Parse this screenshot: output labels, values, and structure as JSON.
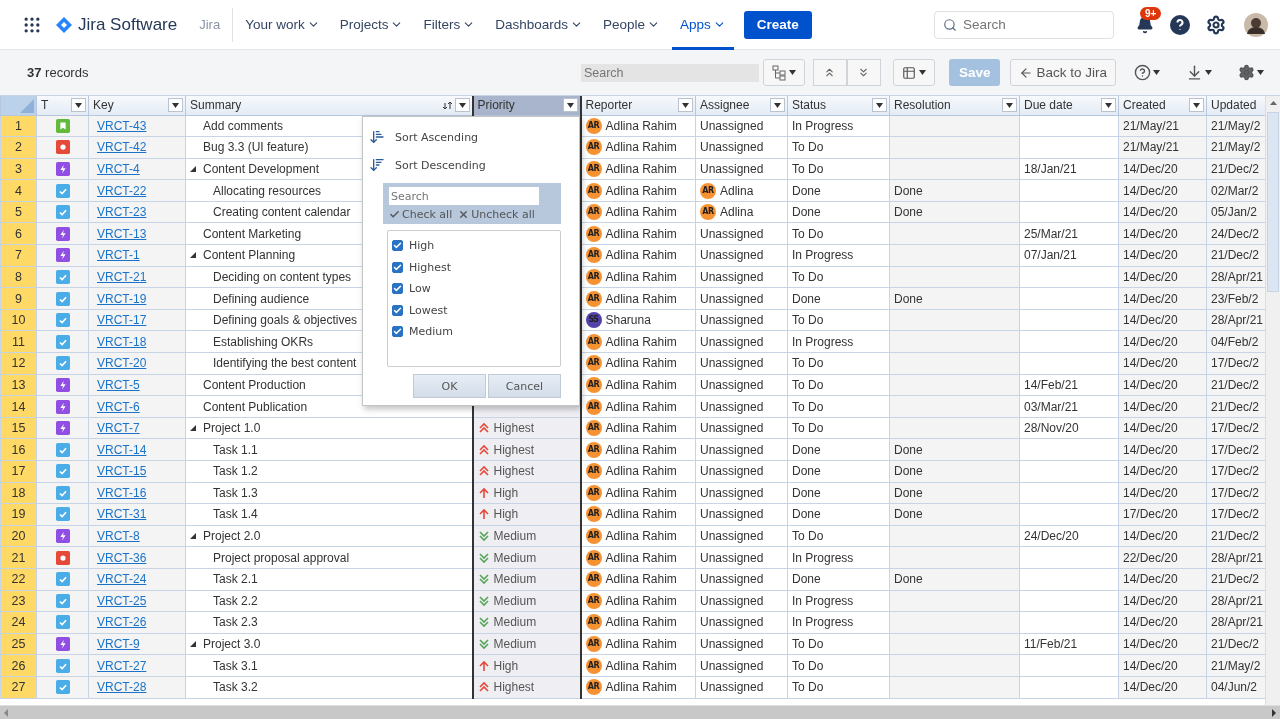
{
  "nav": {
    "product": "Jira Software",
    "site": "Jira",
    "items": [
      {
        "label": "Your work",
        "selected": false
      },
      {
        "label": "Projects",
        "selected": false
      },
      {
        "label": "Filters",
        "selected": false
      },
      {
        "label": "Dashboards",
        "selected": false
      },
      {
        "label": "People",
        "selected": false
      },
      {
        "label": "Apps",
        "selected": true
      }
    ],
    "create": "Create",
    "search": {
      "placeholder": "Search"
    },
    "notifications": "9+"
  },
  "toolbar": {
    "records": "**37** records",
    "search": {
      "placeholder": "Search"
    },
    "save": {
      "label": "Save",
      "disabled": true
    },
    "back": "Back to Jira"
  },
  "columns": [
    {
      "label": "T",
      "sorted": false,
      "active": false
    },
    {
      "label": "Key",
      "sorted": false,
      "active": false
    },
    {
      "label": "Summary",
      "sorted": true,
      "active": false
    },
    {
      "label": "Priority",
      "sorted": false,
      "active": true
    },
    {
      "label": "Reporter",
      "sorted": false,
      "active": false
    },
    {
      "label": "Assignee",
      "sorted": false,
      "active": false
    },
    {
      "label": "Status",
      "sorted": false,
      "active": false
    },
    {
      "label": "Resolution",
      "sorted": false,
      "active": false
    },
    {
      "label": "Due date",
      "sorted": false,
      "active": false
    },
    {
      "label": "Created",
      "sorted": false,
      "active": false
    },
    {
      "label": "Updated",
      "sorted": false,
      "active": false
    }
  ],
  "rows": [
    {
      "num": "1",
      "kind": "story",
      "key": "VRCT-43",
      "summary": "Add comments",
      "reporter": {
        "name": "Adlina Rahim",
        "initials": "AR",
        "color": "#f79232"
      },
      "assignee": {
        "name": "Unassigned"
      },
      "status": "In Progress",
      "created": "21/May/21",
      "updated": "21/May/2"
    },
    {
      "num": "2",
      "kind": "bug",
      "key": "VRCT-42",
      "summary": "Bug 3.3 (UI feature)",
      "reporter": {
        "name": "Adlina Rahim",
        "initials": "AR",
        "color": "#f79232"
      },
      "assignee": {
        "name": "Unassigned"
      },
      "status": "To Do",
      "created": "21/May/21",
      "updated": "21/May/2"
    },
    {
      "num": "3",
      "kind": "epic",
      "key": "VRCT-4",
      "summary": "Content Development",
      "expanded": true,
      "reporter": {
        "name": "Adlina Rahim",
        "initials": "AR",
        "color": "#f79232"
      },
      "assignee": {
        "name": "Unassigned"
      },
      "status": "To Do",
      "due": "18/Jan/21",
      "created": "14/Dec/20",
      "updated": "21/Dec/2",
      "children": [
        {
          "num": "4",
          "kind": "task",
          "key": "VRCT-22",
          "summary": "Allocating resources",
          "reporter": {
            "name": "Adlina Rahim",
            "initials": "AR",
            "color": "#f79232"
          },
          "assignee": {
            "name": "Adlina",
            "initials": "AR",
            "color": "#f79232"
          },
          "status": "Done",
          "resolution": "Done",
          "created": "14/Dec/20",
          "updated": "02/Mar/2"
        },
        {
          "num": "5",
          "kind": "task",
          "key": "VRCT-23",
          "summary": "Creating content calendar",
          "reporter": {
            "name": "Adlina Rahim",
            "initials": "AR",
            "color": "#f79232"
          },
          "assignee": {
            "name": "Adlina",
            "initials": "AR",
            "color": "#f79232"
          },
          "status": "Done",
          "resolution": "Done",
          "created": "14/Dec/20",
          "updated": "05/Jan/2"
        }
      ]
    },
    {
      "num": "6",
      "kind": "epic",
      "key": "VRCT-13",
      "summary": "Content Marketing",
      "reporter": {
        "name": "Adlina Rahim",
        "initials": "AR",
        "color": "#f79232"
      },
      "assignee": {
        "name": "Unassigned"
      },
      "status": "To Do",
      "due": "25/Mar/21",
      "created": "14/Dec/20",
      "updated": "24/Dec/2"
    },
    {
      "num": "7",
      "kind": "epic",
      "key": "VRCT-1",
      "summary": "Content Planning",
      "expanded": true,
      "reporter": {
        "name": "Adlina Rahim",
        "initials": "AR",
        "color": "#f79232"
      },
      "assignee": {
        "name": "Unassigned"
      },
      "status": "In Progress",
      "due": "07/Jan/21",
      "created": "14/Dec/20",
      "updated": "21/Dec/2",
      "children": [
        {
          "num": "8",
          "kind": "task",
          "key": "VRCT-21",
          "summary": "Deciding on content types",
          "reporter": {
            "name": "Adlina Rahim",
            "initials": "AR",
            "color": "#f79232"
          },
          "assignee": {
            "name": "Unassigned"
          },
          "status": "To Do",
          "created": "14/Dec/20",
          "updated": "28/Apr/21"
        },
        {
          "num": "9",
          "kind": "task",
          "key": "VRCT-19",
          "summary": "Defining audience",
          "reporter": {
            "name": "Adlina Rahim",
            "initials": "AR",
            "color": "#f79232"
          },
          "assignee": {
            "name": "Unassigned"
          },
          "status": "Done",
          "resolution": "Done",
          "created": "14/Dec/20",
          "updated": "23/Feb/2"
        },
        {
          "num": "10",
          "kind": "task",
          "key": "VRCT-17",
          "summary": "Defining goals & objectives",
          "reporter": {
            "name": "Sharuna",
            "initials": "SS",
            "color": "#5243aa"
          },
          "assignee": {
            "name": "Unassigned"
          },
          "status": "To Do",
          "created": "14/Dec/20",
          "updated": "28/Apr/21"
        },
        {
          "num": "11",
          "kind": "task",
          "key": "VRCT-18",
          "summary": "Establishing OKRs",
          "reporter": {
            "name": "Adlina Rahim",
            "initials": "AR",
            "color": "#f79232"
          },
          "assignee": {
            "name": "Unassigned"
          },
          "status": "In Progress",
          "created": "14/Dec/20",
          "updated": "04/Feb/2"
        },
        {
          "num": "12",
          "kind": "task",
          "key": "VRCT-20",
          "summary": "Identifying the best content",
          "reporter": {
            "name": "Adlina Rahim",
            "initials": "AR",
            "color": "#f79232"
          },
          "assignee": {
            "name": "Unassigned"
          },
          "status": "To Do",
          "created": "14/Dec/20",
          "updated": "17/Dec/2"
        }
      ]
    },
    {
      "num": "13",
      "kind": "epic",
      "key": "VRCT-5",
      "summary": "Content Production",
      "reporter": {
        "name": "Adlina Rahim",
        "initials": "AR",
        "color": "#f79232"
      },
      "assignee": {
        "name": "Unassigned"
      },
      "status": "To Do",
      "due": "14/Feb/21",
      "created": "14/Dec/20",
      "updated": "21/Dec/2"
    },
    {
      "num": "14",
      "kind": "epic",
      "key": "VRCT-6",
      "summary": "Content Publication",
      "reporter": {
        "name": "Adlina Rahim",
        "initials": "AR",
        "color": "#f79232"
      },
      "assignee": {
        "name": "Unassigned"
      },
      "status": "To Do",
      "due": "03/Mar/21",
      "created": "14/Dec/20",
      "updated": "21/Dec/2"
    },
    {
      "num": "15",
      "kind": "epic",
      "key": "VRCT-7",
      "summary": "Project 1.0",
      "expanded": true,
      "priority": {
        "label": "Highest",
        "kind": "highest"
      },
      "reporter": {
        "name": "Adlina Rahim",
        "initials": "AR",
        "color": "#f79232"
      },
      "assignee": {
        "name": "Unassigned"
      },
      "status": "To Do",
      "due": "28/Nov/20",
      "created": "14/Dec/20",
      "updated": "17/Dec/2",
      "children": [
        {
          "num": "16",
          "kind": "task",
          "key": "VRCT-14",
          "summary": "Task 1.1",
          "priority": {
            "label": "Highest",
            "kind": "highest"
          },
          "reporter": {
            "name": "Adlina Rahim",
            "initials": "AR",
            "color": "#f79232"
          },
          "assignee": {
            "name": "Unassigned"
          },
          "status": "Done",
          "resolution": "Done",
          "created": "14/Dec/20",
          "updated": "17/Dec/2"
        },
        {
          "num": "17",
          "kind": "task",
          "key": "VRCT-15",
          "summary": "Task 1.2",
          "priority": {
            "label": "Highest",
            "kind": "highest"
          },
          "reporter": {
            "name": "Adlina Rahim",
            "initials": "AR",
            "color": "#f79232"
          },
          "assignee": {
            "name": "Unassigned"
          },
          "status": "Done",
          "resolution": "Done",
          "created": "14/Dec/20",
          "updated": "17/Dec/2"
        },
        {
          "num": "18",
          "kind": "task",
          "key": "VRCT-16",
          "summary": "Task 1.3",
          "priority": {
            "label": "High",
            "kind": "high"
          },
          "reporter": {
            "name": "Adlina Rahim",
            "initials": "AR",
            "color": "#f79232"
          },
          "assignee": {
            "name": "Unassigned"
          },
          "status": "Done",
          "resolution": "Done",
          "created": "14/Dec/20",
          "updated": "17/Dec/2"
        },
        {
          "num": "19",
          "kind": "task",
          "key": "VRCT-31",
          "summary": "Task 1.4",
          "priority": {
            "label": "High",
            "kind": "high"
          },
          "reporter": {
            "name": "Adlina Rahim",
            "initials": "AR",
            "color": "#f79232"
          },
          "assignee": {
            "name": "Unassigned"
          },
          "status": "Done",
          "resolution": "Done",
          "created": "17/Dec/20",
          "updated": "17/Dec/2"
        }
      ]
    },
    {
      "num": "20",
      "kind": "epic",
      "key": "VRCT-8",
      "summary": "Project 2.0",
      "expanded": true,
      "priority": {
        "label": "Medium",
        "kind": "medium"
      },
      "reporter": {
        "name": "Adlina Rahim",
        "initials": "AR",
        "color": "#f79232"
      },
      "assignee": {
        "name": "Unassigned"
      },
      "status": "To Do",
      "due": "24/Dec/20",
      "created": "14/Dec/20",
      "updated": "21/Dec/2",
      "children": [
        {
          "num": "21",
          "kind": "bug",
          "key": "VRCT-36",
          "summary": "Project proposal approval",
          "priority": {
            "label": "Medium",
            "kind": "medium"
          },
          "reporter": {
            "name": "Adlina Rahim",
            "initials": "AR",
            "color": "#f79232"
          },
          "assignee": {
            "name": "Unassigned"
          },
          "status": "In Progress",
          "created": "22/Dec/20",
          "updated": "28/Apr/21"
        },
        {
          "num": "22",
          "kind": "task",
          "key": "VRCT-24",
          "summary": "Task 2.1",
          "priority": {
            "label": "Medium",
            "kind": "medium"
          },
          "reporter": {
            "name": "Adlina Rahim",
            "initials": "AR",
            "color": "#f79232"
          },
          "assignee": {
            "name": "Unassigned"
          },
          "status": "Done",
          "resolution": "Done",
          "created": "14/Dec/20",
          "updated": "21/Dec/2"
        },
        {
          "num": "23",
          "kind": "task",
          "key": "VRCT-25",
          "summary": "Task 2.2",
          "priority": {
            "label": "Medium",
            "kind": "medium"
          },
          "reporter": {
            "name": "Adlina Rahim",
            "initials": "AR",
            "color": "#f79232"
          },
          "assignee": {
            "name": "Unassigned"
          },
          "status": "In Progress",
          "created": "14/Dec/20",
          "updated": "28/Apr/21"
        },
        {
          "num": "24",
          "kind": "task",
          "key": "VRCT-26",
          "summary": "Task 2.3",
          "priority": {
            "label": "Medium",
            "kind": "medium"
          },
          "reporter": {
            "name": "Adlina Rahim",
            "initials": "AR",
            "color": "#f79232"
          },
          "assignee": {
            "name": "Unassigned"
          },
          "status": "In Progress",
          "created": "14/Dec/20",
          "updated": "28/Apr/21"
        }
      ]
    },
    {
      "num": "25",
      "kind": "epic",
      "key": "VRCT-9",
      "summary": "Project 3.0",
      "expanded": true,
      "priority": {
        "label": "Medium",
        "kind": "medium"
      },
      "reporter": {
        "name": "Adlina Rahim",
        "initials": "AR",
        "color": "#f79232"
      },
      "assignee": {
        "name": "Unassigned"
      },
      "status": "To Do",
      "due": "11/Feb/21",
      "created": "14/Dec/20",
      "updated": "21/Dec/2",
      "children": [
        {
          "num": "26",
          "kind": "task",
          "key": "VRCT-27",
          "summary": "Task 3.1",
          "priority": {
            "label": "High",
            "kind": "high"
          },
          "reporter": {
            "name": "Adlina Rahim",
            "initials": "AR",
            "color": "#f79232"
          },
          "assignee": {
            "name": "Unassigned"
          },
          "status": "To Do",
          "created": "14/Dec/20",
          "updated": "21/May/2"
        },
        {
          "num": "27",
          "kind": "task",
          "key": "VRCT-28",
          "summary": "Task 3.2",
          "priority": {
            "label": "Highest",
            "kind": "highest"
          },
          "reporter": {
            "name": "Adlina Rahim",
            "initials": "AR",
            "color": "#f79232"
          },
          "assignee": {
            "name": "Unassigned"
          },
          "status": "To Do",
          "created": "14/Dec/20",
          "updated": "04/Jun/2"
        }
      ]
    }
  ],
  "filter_popup": {
    "sort_ascending": "Sort Ascending",
    "sort_descending": "Sort Descending",
    "search": {
      "placeholder": "Search"
    },
    "check_all": "Check all",
    "uncheck_all": "Uncheck all",
    "options": [
      {
        "label": "High",
        "checked": true
      },
      {
        "label": "Highest",
        "checked": true
      },
      {
        "label": "Low",
        "checked": true
      },
      {
        "label": "Lowest",
        "checked": true
      },
      {
        "label": "Medium",
        "checked": true
      }
    ],
    "ok": "OK",
    "cancel": "Cancel"
  }
}
